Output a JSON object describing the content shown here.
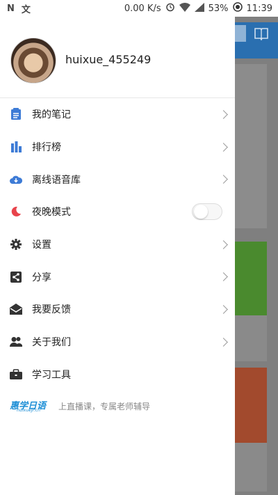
{
  "status_bar": {
    "left_icons": [
      "N",
      "文"
    ],
    "net_speed": "0.00 K/s",
    "battery": "53%",
    "time": "11:39"
  },
  "profile": {
    "username": "huixue_455249"
  },
  "menu": [
    {
      "label": "我的笔记",
      "icon": "notes-icon",
      "color": "#3d7bd6",
      "has_arrow": true
    },
    {
      "label": "排行榜",
      "icon": "bar-chart-icon",
      "color": "#3d7bd6",
      "has_arrow": true
    },
    {
      "label": "离线语音库",
      "icon": "cloud-download-icon",
      "color": "#3d7bd6",
      "has_arrow": true
    },
    {
      "label": "夜晚模式",
      "icon": "moon-icon",
      "color": "#e8434b",
      "has_toggle": true,
      "toggle_on": false
    },
    {
      "label": "设置",
      "icon": "gear-icon",
      "color": "#333333",
      "has_arrow": true
    },
    {
      "label": "分享",
      "icon": "share-icon",
      "color": "#333333",
      "has_arrow": true
    },
    {
      "label": "我要反馈",
      "icon": "mail-icon",
      "color": "#333333",
      "has_arrow": true
    },
    {
      "label": "关于我们",
      "icon": "users-icon",
      "color": "#333333",
      "has_arrow": true
    },
    {
      "label": "学习工具",
      "icon": "toolbox-icon",
      "color": "#333333",
      "has_arrow": false
    }
  ],
  "promo": {
    "logo_text": "惠学日语",
    "logo_sub": "huixueJP.cn",
    "text": "上直播课，专属老师辅导"
  },
  "colors": {
    "brand_blue": "#3d7bd6",
    "night_red": "#e8434b"
  }
}
